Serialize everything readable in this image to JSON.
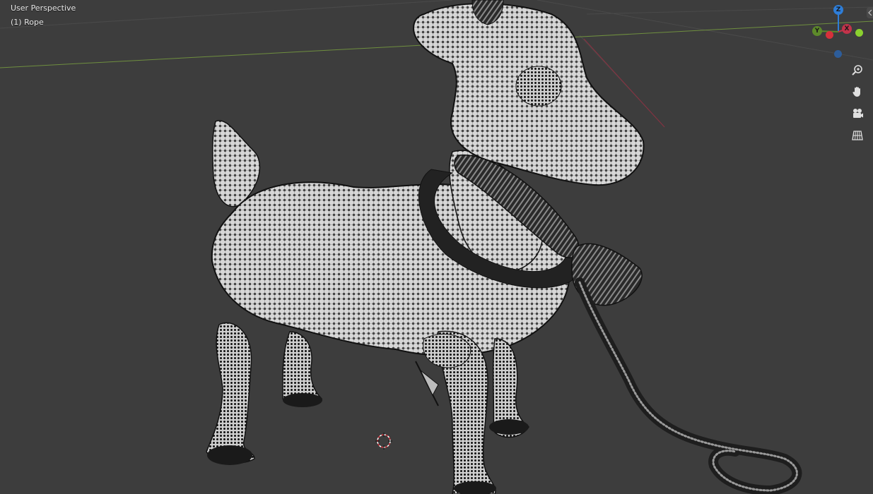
{
  "viewport": {
    "perspective_label": "User Perspective",
    "object_label": "(1) Rope",
    "background_color": "#3d3d3d"
  },
  "gizmo": {
    "axes": [
      {
        "name": "z-axis",
        "label": "Z",
        "color": "#2e7dd7"
      },
      {
        "name": "y-axis",
        "label": "Y",
        "color": "#5d8a2a"
      },
      {
        "name": "x-axis",
        "label": "X",
        "color": "#c2334a"
      }
    ]
  },
  "nav_tools": [
    {
      "name": "zoom",
      "icon": "magnifier-plus-icon"
    },
    {
      "name": "pan",
      "icon": "hand-icon"
    },
    {
      "name": "camera-view",
      "icon": "camera-icon"
    },
    {
      "name": "perspective-toggle",
      "icon": "grid-icon"
    }
  ],
  "scene": {
    "model": "cow-wireframe",
    "object": "rope"
  }
}
